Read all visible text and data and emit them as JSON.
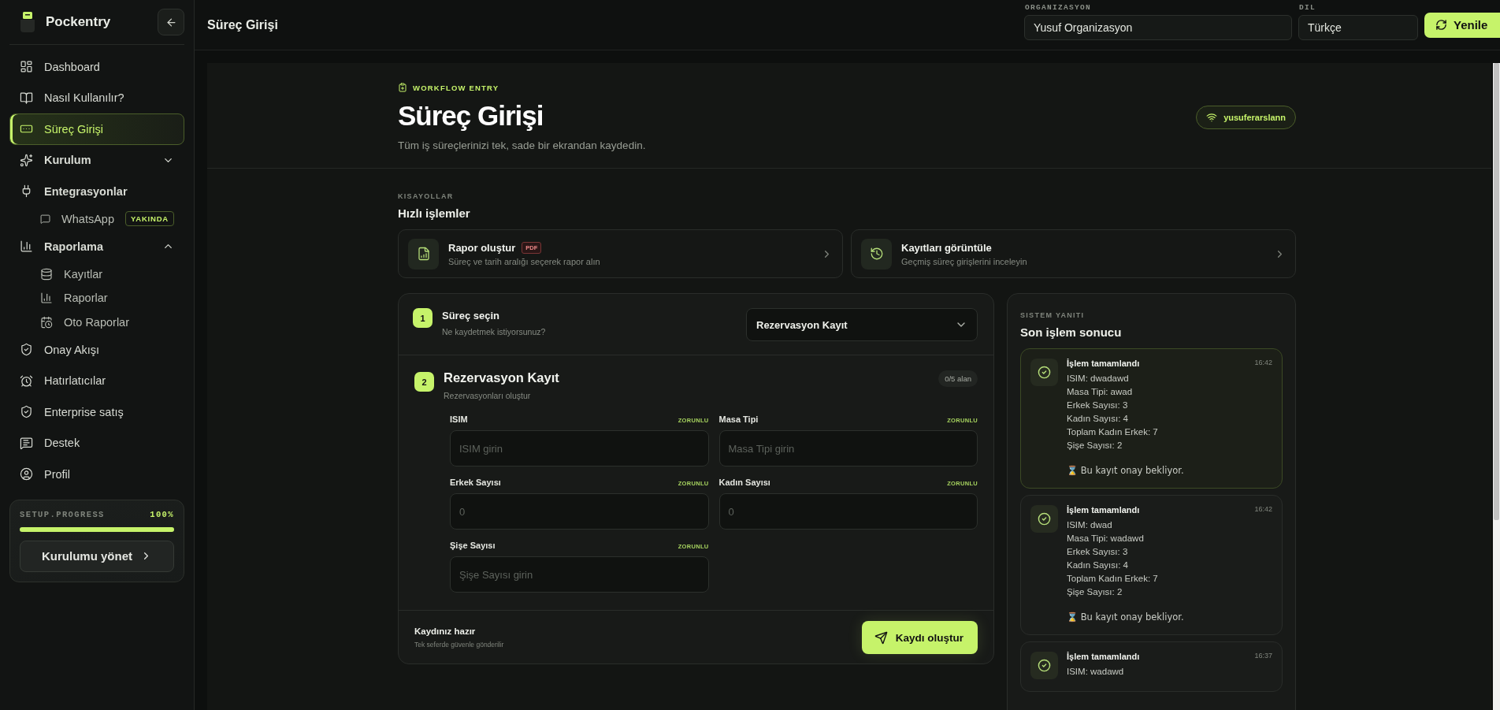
{
  "sidebar": {
    "brand": "Pockentry",
    "items": [
      {
        "kind": "link",
        "label": "Dashboard",
        "selected": false
      },
      {
        "kind": "link",
        "label": "Nasıl Kullanılır?",
        "selected": false
      },
      {
        "kind": "link",
        "label": "Süreç Girişi",
        "selected": true
      },
      {
        "kind": "group",
        "label": "Kurulum",
        "expanded": false
      },
      {
        "kind": "section",
        "label": "Entegrasyonlar",
        "children": [
          {
            "label": "WhatsApp",
            "badge": "YAKINDA",
            "selected": false
          }
        ]
      },
      {
        "kind": "group",
        "label": "Raporlama",
        "expanded": true,
        "children": [
          {
            "label": "Kayıtlar",
            "selected": false
          },
          {
            "label": "Raporlar",
            "selected": false
          },
          {
            "label": "Oto Raporlar",
            "selected": false
          }
        ]
      },
      {
        "kind": "link",
        "label": "Onay Akışı",
        "selected": false
      },
      {
        "kind": "link",
        "label": "Hatırlatıcılar",
        "selected": false
      },
      {
        "kind": "link",
        "label": "Enterprise satış",
        "selected": false
      },
      {
        "kind": "link",
        "label": "Destek",
        "selected": false
      },
      {
        "kind": "link",
        "label": "Profil",
        "selected": false
      }
    ],
    "setup": {
      "label": "SETUP.PROGRESS",
      "reading": "100%",
      "level": 1,
      "button": "Kurulumu yönet"
    }
  },
  "topbar": {
    "title": "Süreç Girişi",
    "organization": {
      "label": "ORGANIZASYON",
      "value": "Yusuf Organizasyon"
    },
    "language": {
      "label": "DIL",
      "value": "Türkçe"
    },
    "refresh": "Yenile"
  },
  "header": {
    "eyebrow": "WORKFLOW ENTRY",
    "title": "Süreç Girişi",
    "subtitle": "Tüm iş süreçlerinizi tek, sade bir ekrandan kaydedin.",
    "user": "yusuferarslann"
  },
  "shortcuts": {
    "eyebrow": "KISAYOLLAR",
    "title": "Hızlı işlemler",
    "items": [
      {
        "title": "Rapor oluştur",
        "badge": "PDF",
        "subtitle": "Süreç ve tarih aralığı seçerek rapor alın"
      },
      {
        "title": "Kayıtları görüntüle",
        "subtitle": "Geçmiş süreç girişlerini inceleyin"
      }
    ]
  },
  "form": {
    "step1": {
      "number": "1",
      "title": "Süreç seçin",
      "subtitle": "Ne kaydetmek istiyorsunuz?",
      "value": "Rezervasyon Kayıt"
    },
    "step2": {
      "number": "2",
      "title": "Rezervasyon Kayıt",
      "subtitle": "Rezervasyonları oluştur",
      "counter": "0/5 alan",
      "fields": [
        {
          "label": "ISIM",
          "tag": "ZORUNLU",
          "placeholder": "ISIM girin"
        },
        {
          "label": "Masa Tipi",
          "tag": "ZORUNLU",
          "placeholder": "Masa Tipi girin"
        },
        {
          "label": "Erkek Sayısı",
          "tag": "ZORUNLU",
          "placeholder": "0"
        },
        {
          "label": "Kadın Sayısı",
          "tag": "ZORUNLU",
          "placeholder": "0"
        },
        {
          "label": "Şişe Sayısı",
          "tag": "ZORUNLU",
          "placeholder": "Şişe Sayısı girin"
        }
      ]
    },
    "footer": {
      "title": "Kaydınız hazır",
      "subtitle": "Tek seferde güvenle gönderilir",
      "button": "Kaydı oluştur"
    }
  },
  "results": {
    "eyebrow": "SISTEM YANITI",
    "title": "Son işlem sonucu",
    "items": [
      {
        "title": "İşlem tamamlandı",
        "time": "16:42",
        "selected": true,
        "lines": [
          "ISIM: dwadawd",
          "Masa Tipi: awad",
          "Erkek Sayısı: 3",
          "Kadın Sayısı: 4",
          "Toplam Kadın Erkek: 7",
          "Şişe Sayısı: 2"
        ],
        "note": "⌛ Bu kayıt onay bekliyor."
      },
      {
        "title": "İşlem tamamlandı",
        "time": "16:42",
        "selected": false,
        "lines": [
          "ISIM: dwad",
          "Masa Tipi: wadawd",
          "Erkek Sayısı: 3",
          "Kadın Sayısı: 4",
          "Toplam Kadın Erkek: 7",
          "Şişe Sayısı: 2"
        ],
        "note": "⌛ Bu kayıt onay bekliyor."
      },
      {
        "title": "İşlem tamamlandı",
        "time": "16:37",
        "selected": false,
        "lines": [
          "ISIM: wadawd"
        ]
      }
    ]
  }
}
